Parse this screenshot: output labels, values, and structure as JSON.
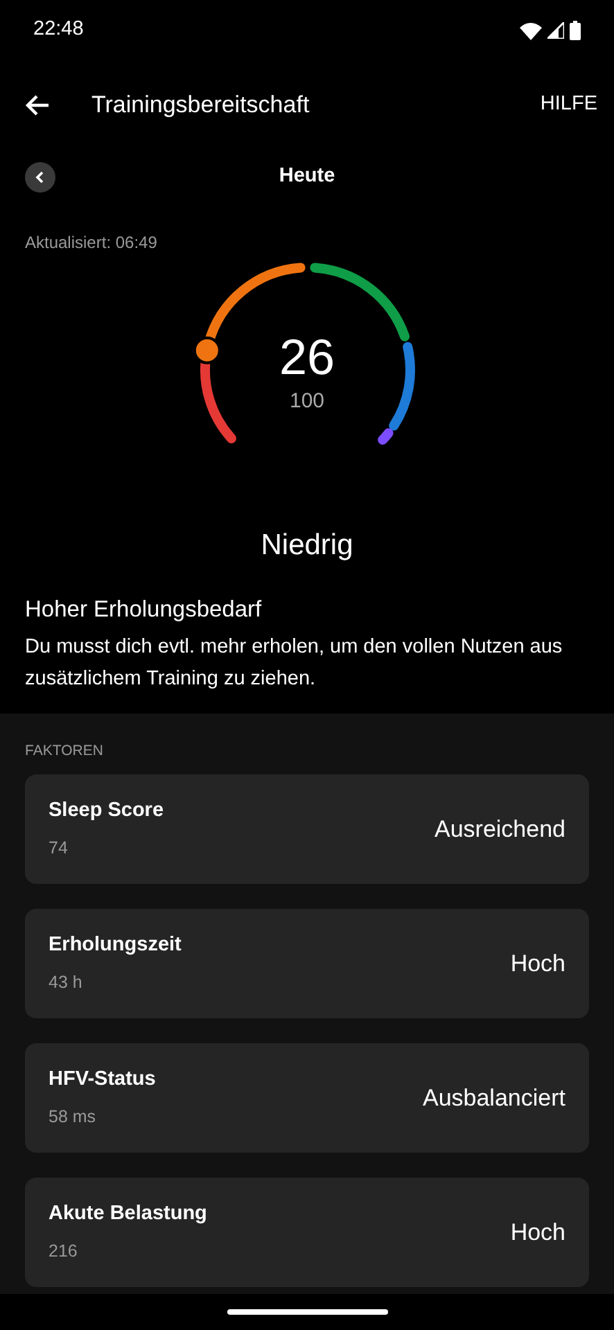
{
  "status_bar": {
    "time": "22:48"
  },
  "app_bar": {
    "title": "Trainingsbereitschaft",
    "action": "HILFE"
  },
  "day_nav": {
    "label": "Heute"
  },
  "updated": "Aktualisiert: 06:49",
  "gauge": {
    "value": "26",
    "max": "100",
    "rating": "Niedrig"
  },
  "summary": {
    "heading": "Hoher Erholungsbedarf",
    "text": "Du musst dich evtl. mehr erholen, um den vollen Nutzen aus zusätzlichem Training zu ziehen."
  },
  "factors": {
    "title": "FAKTOREN",
    "items": [
      {
        "name": "Sleep Score",
        "value": "74",
        "rating": "Ausreichend"
      },
      {
        "name": "Erholungszeit",
        "value": "43 h",
        "rating": "Hoch"
      },
      {
        "name": "HFV-Status",
        "value": "58 ms",
        "rating": "Ausbalanciert"
      },
      {
        "name": "Akute Belastung",
        "value": "216",
        "rating": "Hoch"
      }
    ]
  }
}
